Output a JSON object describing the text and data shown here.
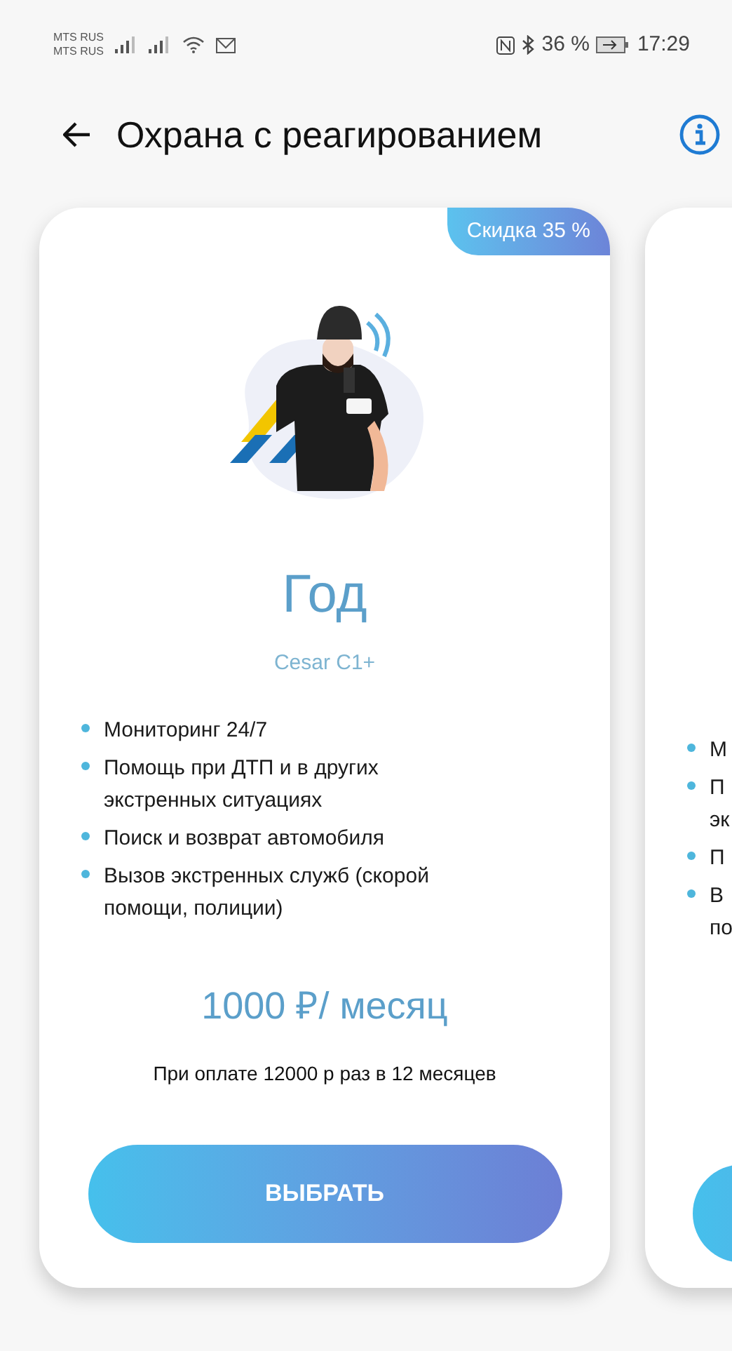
{
  "status_bar": {
    "carriers": [
      "MTS RUS",
      "MTS RUS"
    ],
    "battery_percent": "36 %",
    "time": "17:29"
  },
  "header": {
    "title": "Охрана с реагированием"
  },
  "cards": [
    {
      "badge": "Скидка 35 %",
      "title": "Год",
      "subtitle": "Cesar C1+",
      "features": [
        [
          "Мониторинг 24/7"
        ],
        [
          "Помощь при ДТП и в других",
          "экстренных ситуациях"
        ],
        [
          "Поиск и возврат автомобиля"
        ],
        [
          "Вызов экстренных служб (скорой",
          "помощи, полиции)"
        ]
      ],
      "price": "1000 ₽/ месяц",
      "note": "При оплате 12000 р раз в 12 месяцев",
      "button": "ВЫБРАТЬ"
    },
    {
      "features": [
        [
          "М"
        ],
        [
          "П",
          "эк"
        ],
        [
          "П"
        ],
        [
          "В",
          "по"
        ]
      ]
    }
  ]
}
